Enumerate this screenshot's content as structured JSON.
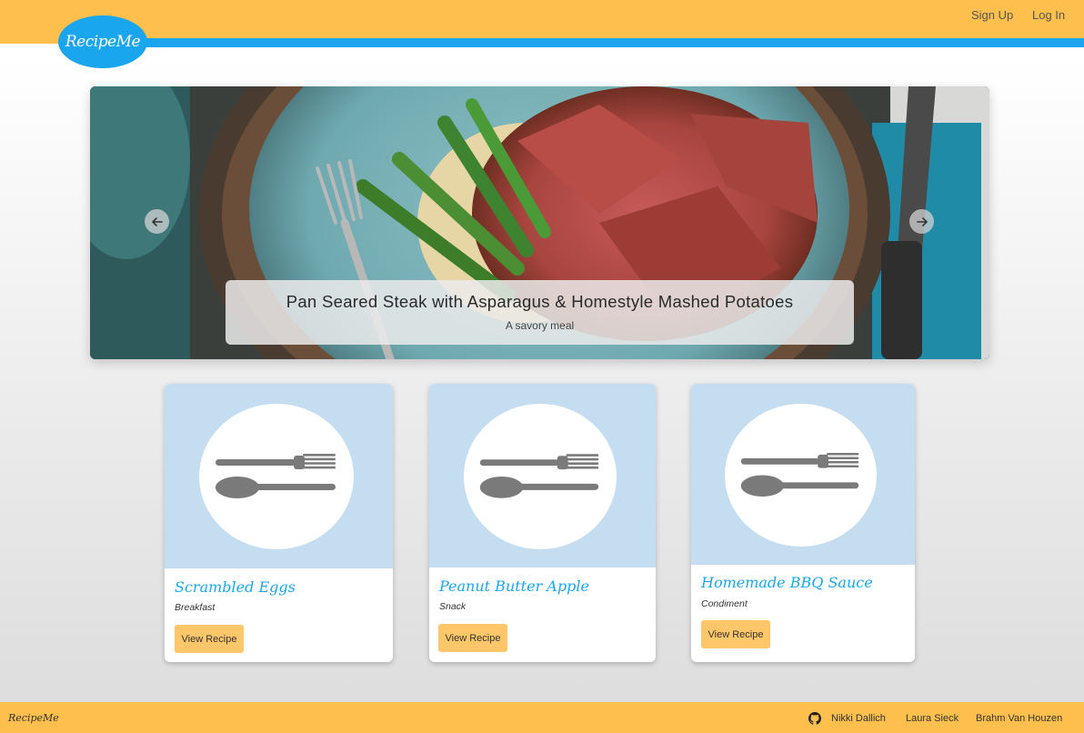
{
  "header": {
    "logo_text": "RecipeMe",
    "signup_label": "Sign Up",
    "login_label": "Log In"
  },
  "carousel": {
    "title": "Pan Seared Steak with Asparagus & Homestyle Mashed Potatoes",
    "subtitle": "A savory meal",
    "prev_icon": "arrow-left-icon",
    "next_icon": "arrow-right-icon"
  },
  "recipes": [
    {
      "title": "Scrambled Eggs",
      "category": "Breakfast",
      "button_label": "View Recipe",
      "icon": "fork-spoon-icon"
    },
    {
      "title": "Peanut Butter Apple",
      "category": "Snack",
      "button_label": "View Recipe",
      "icon": "fork-spoon-icon"
    },
    {
      "title": "Homemade BBQ Sauce",
      "category": "Condiment",
      "button_label": "View Recipe",
      "icon": "fork-spoon-icon"
    }
  ],
  "footer": {
    "brand": "RecipeMe",
    "github_icon": "github-icon",
    "authors": [
      "Nikki Dallich",
      "Laura Sieck",
      "Brahm Van Houzen"
    ]
  },
  "colors": {
    "accent_yellow": "#ffbf4d",
    "accent_blue": "#1aa6ee",
    "card_image_bg": "#c5ddf0",
    "button_bg": "#ffc769"
  }
}
